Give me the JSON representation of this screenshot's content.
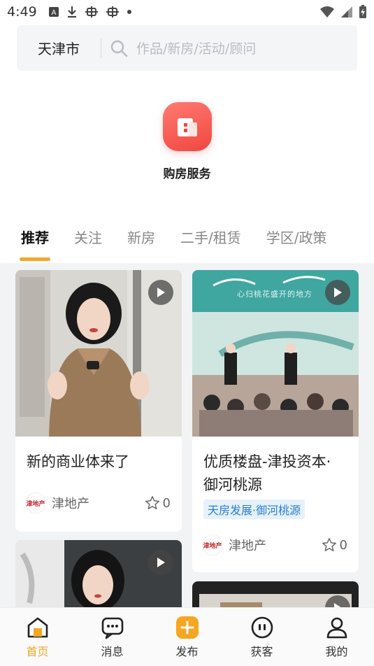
{
  "status_bar": {
    "time": "4:49",
    "icons": [
      "a-badge-icon",
      "download-icon",
      "bug-icon",
      "bug-icon",
      "dot-icon"
    ],
    "right_icons": [
      "wifi-icon",
      "signal-icon",
      "battery-charging-icon"
    ]
  },
  "search": {
    "city": "天津市",
    "placeholder": "作品/新房/活动/顾问"
  },
  "service": {
    "label": "购房服务",
    "icon": "building-icon",
    "color": "#f0473f"
  },
  "tabs": [
    {
      "label": "推荐",
      "active": true
    },
    {
      "label": "关注",
      "active": false
    },
    {
      "label": "新房",
      "active": false
    },
    {
      "label": "二手/租赁",
      "active": false
    },
    {
      "label": "学区/政策",
      "active": false
    }
  ],
  "feed": {
    "cards": [
      {
        "title": "新的商业体来了",
        "tag": "",
        "author": "津地产",
        "likes": "0",
        "has_video": true
      },
      {
        "title": "优质楼盘-津投资本·御河桃源",
        "tag": "天房发展·御河桃源",
        "author": "津地产",
        "likes": "0",
        "has_video": true,
        "banner_text": "心归桃花盛开的地方"
      },
      {
        "title": "",
        "has_video": true
      },
      {
        "title": "",
        "has_video": true
      }
    ]
  },
  "bottom_nav": [
    {
      "label": "首页",
      "icon": "home-icon",
      "active": true
    },
    {
      "label": "消息",
      "icon": "message-icon",
      "active": false
    },
    {
      "label": "发布",
      "icon": "publish-plus-icon",
      "active": false
    },
    {
      "label": "获客",
      "icon": "customer-icon",
      "active": false
    },
    {
      "label": "我的",
      "icon": "profile-icon",
      "active": false
    }
  ],
  "colors": {
    "accent": "#f5a623",
    "tag_blue": "#2a7fd4",
    "service_red": "#f0473f"
  }
}
